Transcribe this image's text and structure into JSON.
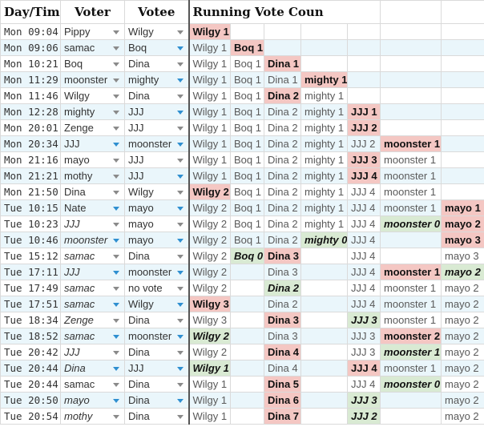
{
  "headers": {
    "day_time": "Day/Time",
    "voter": "Voter",
    "votee": "Votee",
    "running": "Running Vote Coun"
  },
  "colors": {
    "red_highlight": "#f4c7c3",
    "green_highlight": "#d9ead3",
    "alt_row": "#eaf6fb",
    "dropdown_blue": "#2f8fd0"
  },
  "rows": [
    {
      "time": "Mon 09:04",
      "voter": "Pippy",
      "votee": "Wilgy",
      "alt": false,
      "voter_arrow": "gray",
      "votee_arrow": "gray",
      "voter_italic": false,
      "counts": [
        {
          "t": "Wilgy 1",
          "s": "red"
        },
        {
          "t": "",
          "s": ""
        },
        {
          "t": "",
          "s": ""
        },
        {
          "t": "",
          "s": ""
        },
        {
          "t": "",
          "s": ""
        },
        {
          "t": "",
          "s": ""
        },
        {
          "t": "",
          "s": ""
        }
      ]
    },
    {
      "time": "Mon 09:06",
      "voter": "samac",
      "votee": "Boq",
      "alt": true,
      "voter_arrow": "gray",
      "votee_arrow": "blue",
      "voter_italic": false,
      "counts": [
        {
          "t": "Wilgy 1",
          "s": ""
        },
        {
          "t": "Boq 1",
          "s": "red"
        },
        {
          "t": "",
          "s": ""
        },
        {
          "t": "",
          "s": ""
        },
        {
          "t": "",
          "s": ""
        },
        {
          "t": "",
          "s": ""
        },
        {
          "t": "",
          "s": ""
        }
      ]
    },
    {
      "time": "Mon 10:21",
      "voter": "Boq",
      "votee": "Dina",
      "alt": false,
      "voter_arrow": "gray",
      "votee_arrow": "gray",
      "voter_italic": false,
      "counts": [
        {
          "t": "Wilgy 1",
          "s": ""
        },
        {
          "t": "Boq 1",
          "s": ""
        },
        {
          "t": "Dina 1",
          "s": "red"
        },
        {
          "t": "",
          "s": ""
        },
        {
          "t": "",
          "s": ""
        },
        {
          "t": "",
          "s": ""
        },
        {
          "t": "",
          "s": ""
        }
      ]
    },
    {
      "time": "Mon 11:29",
      "voter": "moonster",
      "votee": "mighty",
      "alt": true,
      "voter_arrow": "gray",
      "votee_arrow": "blue",
      "voter_italic": false,
      "counts": [
        {
          "t": "Wilgy 1",
          "s": ""
        },
        {
          "t": "Boq 1",
          "s": ""
        },
        {
          "t": "Dina 1",
          "s": ""
        },
        {
          "t": "mighty 1",
          "s": "red"
        },
        {
          "t": "",
          "s": ""
        },
        {
          "t": "",
          "s": ""
        },
        {
          "t": "",
          "s": ""
        }
      ]
    },
    {
      "time": "Mon 11:46",
      "voter": "Wilgy",
      "votee": "Dina",
      "alt": false,
      "voter_arrow": "gray",
      "votee_arrow": "gray",
      "voter_italic": false,
      "counts": [
        {
          "t": "Wilgy 1",
          "s": ""
        },
        {
          "t": "Boq 1",
          "s": ""
        },
        {
          "t": "Dina 2",
          "s": "red"
        },
        {
          "t": "mighty 1",
          "s": ""
        },
        {
          "t": "",
          "s": ""
        },
        {
          "t": "",
          "s": ""
        },
        {
          "t": "",
          "s": ""
        }
      ]
    },
    {
      "time": "Mon 12:28",
      "voter": "mighty",
      "votee": "JJJ",
      "alt": true,
      "voter_arrow": "gray",
      "votee_arrow": "blue",
      "voter_italic": false,
      "counts": [
        {
          "t": "Wilgy 1",
          "s": ""
        },
        {
          "t": "Boq 1",
          "s": ""
        },
        {
          "t": "Dina 2",
          "s": ""
        },
        {
          "t": "mighty 1",
          "s": ""
        },
        {
          "t": "JJJ 1",
          "s": "red"
        },
        {
          "t": "",
          "s": ""
        },
        {
          "t": "",
          "s": ""
        }
      ]
    },
    {
      "time": "Mon 20:01",
      "voter": "Zenge",
      "votee": "JJJ",
      "alt": false,
      "voter_arrow": "gray",
      "votee_arrow": "gray",
      "voter_italic": false,
      "counts": [
        {
          "t": "Wilgy 1",
          "s": ""
        },
        {
          "t": "Boq 1",
          "s": ""
        },
        {
          "t": "Dina 2",
          "s": ""
        },
        {
          "t": "mighty 1",
          "s": ""
        },
        {
          "t": "JJJ 2",
          "s": "red"
        },
        {
          "t": "",
          "s": ""
        },
        {
          "t": "",
          "s": ""
        }
      ]
    },
    {
      "time": "Mon 20:34",
      "voter": "JJJ",
      "votee": "moonster",
      "alt": true,
      "voter_arrow": "blue",
      "votee_arrow": "blue",
      "voter_italic": false,
      "counts": [
        {
          "t": "Wilgy 1",
          "s": ""
        },
        {
          "t": "Boq 1",
          "s": ""
        },
        {
          "t": "Dina 2",
          "s": ""
        },
        {
          "t": "mighty 1",
          "s": ""
        },
        {
          "t": "JJJ 2",
          "s": ""
        },
        {
          "t": "moonster 1",
          "s": "red"
        },
        {
          "t": "",
          "s": ""
        }
      ]
    },
    {
      "time": "Mon 21:16",
      "voter": "mayo",
      "votee": "JJJ",
      "alt": false,
      "voter_arrow": "gray",
      "votee_arrow": "gray",
      "voter_italic": false,
      "counts": [
        {
          "t": "Wilgy 1",
          "s": ""
        },
        {
          "t": "Boq 1",
          "s": ""
        },
        {
          "t": "Dina 2",
          "s": ""
        },
        {
          "t": "mighty 1",
          "s": ""
        },
        {
          "t": "JJJ 3",
          "s": "red"
        },
        {
          "t": "moonster 1",
          "s": ""
        },
        {
          "t": "",
          "s": ""
        }
      ]
    },
    {
      "time": "Mon 21:21",
      "voter": "mothy",
      "votee": "JJJ",
      "alt": true,
      "voter_arrow": "gray",
      "votee_arrow": "blue",
      "voter_italic": false,
      "counts": [
        {
          "t": "Wilgy 1",
          "s": ""
        },
        {
          "t": "Boq 1",
          "s": ""
        },
        {
          "t": "Dina 2",
          "s": ""
        },
        {
          "t": "mighty 1",
          "s": ""
        },
        {
          "t": "JJJ 4",
          "s": "red"
        },
        {
          "t": "moonster 1",
          "s": ""
        },
        {
          "t": "",
          "s": ""
        }
      ]
    },
    {
      "time": "Mon 21:50",
      "voter": "Dina",
      "votee": "Wilgy",
      "alt": false,
      "voter_arrow": "gray",
      "votee_arrow": "gray",
      "voter_italic": false,
      "counts": [
        {
          "t": "Wilgy 2",
          "s": "red"
        },
        {
          "t": "Boq 1",
          "s": ""
        },
        {
          "t": "Dina 2",
          "s": ""
        },
        {
          "t": "mighty 1",
          "s": ""
        },
        {
          "t": "JJJ 4",
          "s": ""
        },
        {
          "t": "moonster 1",
          "s": ""
        },
        {
          "t": "",
          "s": ""
        }
      ]
    },
    {
      "time": "Tue 10:15",
      "voter": "Nate",
      "votee": "mayo",
      "alt": true,
      "voter_arrow": "blue",
      "votee_arrow": "blue",
      "voter_italic": false,
      "counts": [
        {
          "t": "Wilgy 2",
          "s": ""
        },
        {
          "t": "Boq 1",
          "s": ""
        },
        {
          "t": "Dina 2",
          "s": ""
        },
        {
          "t": "mighty 1",
          "s": ""
        },
        {
          "t": "JJJ 4",
          "s": ""
        },
        {
          "t": "moonster 1",
          "s": ""
        },
        {
          "t": "mayo 1",
          "s": "red"
        }
      ]
    },
    {
      "time": "Tue 10:23",
      "voter": "JJJ",
      "votee": "mayo",
      "alt": false,
      "voter_arrow": "gray",
      "votee_arrow": "gray",
      "voter_italic": true,
      "counts": [
        {
          "t": "Wilgy 2",
          "s": ""
        },
        {
          "t": "Boq 1",
          "s": ""
        },
        {
          "t": "Dina 2",
          "s": ""
        },
        {
          "t": "mighty 1",
          "s": ""
        },
        {
          "t": "JJJ 4",
          "s": ""
        },
        {
          "t": "moonster 0",
          "s": "green"
        },
        {
          "t": "mayo 2",
          "s": "red"
        }
      ]
    },
    {
      "time": "Tue 10:46",
      "voter": "moonster",
      "votee": "mayo",
      "alt": true,
      "voter_arrow": "blue",
      "votee_arrow": "blue",
      "voter_italic": true,
      "counts": [
        {
          "t": "Wilgy 2",
          "s": ""
        },
        {
          "t": "Boq 1",
          "s": ""
        },
        {
          "t": "Dina 2",
          "s": ""
        },
        {
          "t": "mighty 0",
          "s": "green"
        },
        {
          "t": "JJJ 4",
          "s": ""
        },
        {
          "t": "",
          "s": ""
        },
        {
          "t": "mayo 3",
          "s": "red"
        }
      ]
    },
    {
      "time": "Tue 15:12",
      "voter": "samac",
      "votee": "Dina",
      "alt": false,
      "voter_arrow": "gray",
      "votee_arrow": "gray",
      "voter_italic": true,
      "counts": [
        {
          "t": "Wilgy 2",
          "s": ""
        },
        {
          "t": "Boq 0",
          "s": "green"
        },
        {
          "t": "Dina 3",
          "s": "red"
        },
        {
          "t": "",
          "s": ""
        },
        {
          "t": "JJJ 4",
          "s": ""
        },
        {
          "t": "",
          "s": ""
        },
        {
          "t": "mayo 3",
          "s": ""
        }
      ]
    },
    {
      "time": "Tue 17:11",
      "voter": "JJJ",
      "votee": "moonster",
      "alt": true,
      "voter_arrow": "blue",
      "votee_arrow": "blue",
      "voter_italic": true,
      "counts": [
        {
          "t": "Wilgy 2",
          "s": ""
        },
        {
          "t": "",
          "s": ""
        },
        {
          "t": "Dina 3",
          "s": ""
        },
        {
          "t": "",
          "s": ""
        },
        {
          "t": "JJJ 4",
          "s": ""
        },
        {
          "t": "moonster 1",
          "s": "red"
        },
        {
          "t": "mayo 2",
          "s": "green"
        }
      ]
    },
    {
      "time": "Tue 17:49",
      "voter": "samac",
      "votee": "no vote",
      "alt": false,
      "voter_arrow": "gray",
      "votee_arrow": "gray",
      "voter_italic": true,
      "counts": [
        {
          "t": "Wilgy 2",
          "s": ""
        },
        {
          "t": "",
          "s": ""
        },
        {
          "t": "Dina 2",
          "s": "green"
        },
        {
          "t": "",
          "s": ""
        },
        {
          "t": "JJJ 4",
          "s": ""
        },
        {
          "t": "moonster 1",
          "s": ""
        },
        {
          "t": "mayo 2",
          "s": ""
        }
      ]
    },
    {
      "time": "Tue 17:51",
      "voter": "samac",
      "votee": "Wilgy",
      "alt": true,
      "voter_arrow": "blue",
      "votee_arrow": "blue",
      "voter_italic": true,
      "counts": [
        {
          "t": "Wilgy 3",
          "s": "red"
        },
        {
          "t": "",
          "s": ""
        },
        {
          "t": "Dina 2",
          "s": ""
        },
        {
          "t": "",
          "s": ""
        },
        {
          "t": "JJJ 4",
          "s": ""
        },
        {
          "t": "moonster 1",
          "s": ""
        },
        {
          "t": "mayo 2",
          "s": ""
        }
      ]
    },
    {
      "time": "Tue 18:34",
      "voter": "Zenge",
      "votee": "Dina",
      "alt": false,
      "voter_arrow": "gray",
      "votee_arrow": "gray",
      "voter_italic": true,
      "counts": [
        {
          "t": "Wilgy 3",
          "s": ""
        },
        {
          "t": "",
          "s": ""
        },
        {
          "t": "Dina 3",
          "s": "red"
        },
        {
          "t": "",
          "s": ""
        },
        {
          "t": "JJJ 3",
          "s": "green"
        },
        {
          "t": "moonster 1",
          "s": ""
        },
        {
          "t": "mayo 2",
          "s": ""
        }
      ]
    },
    {
      "time": "Tue 18:52",
      "voter": "samac",
      "votee": "moonster",
      "alt": true,
      "voter_arrow": "blue",
      "votee_arrow": "blue",
      "voter_italic": true,
      "counts": [
        {
          "t": "Wilgy 2",
          "s": "green"
        },
        {
          "t": "",
          "s": ""
        },
        {
          "t": "Dina 3",
          "s": ""
        },
        {
          "t": "",
          "s": ""
        },
        {
          "t": "JJJ 3",
          "s": ""
        },
        {
          "t": "moonster 2",
          "s": "red"
        },
        {
          "t": "mayo 2",
          "s": ""
        }
      ]
    },
    {
      "time": "Tue 20:42",
      "voter": "JJJ",
      "votee": "Dina",
      "alt": false,
      "voter_arrow": "gray",
      "votee_arrow": "gray",
      "voter_italic": true,
      "counts": [
        {
          "t": "Wilgy 2",
          "s": ""
        },
        {
          "t": "",
          "s": ""
        },
        {
          "t": "Dina 4",
          "s": "red"
        },
        {
          "t": "",
          "s": ""
        },
        {
          "t": "JJJ 3",
          "s": ""
        },
        {
          "t": "moonster 1",
          "s": "green"
        },
        {
          "t": "mayo 2",
          "s": ""
        }
      ]
    },
    {
      "time": "Tue 20:44",
      "voter": "Dina",
      "votee": "JJJ",
      "alt": true,
      "voter_arrow": "blue",
      "votee_arrow": "blue",
      "voter_italic": true,
      "counts": [
        {
          "t": "Wilgy 1",
          "s": "green"
        },
        {
          "t": "",
          "s": ""
        },
        {
          "t": "Dina 4",
          "s": ""
        },
        {
          "t": "",
          "s": ""
        },
        {
          "t": "JJJ 4",
          "s": "red"
        },
        {
          "t": "moonster 1",
          "s": ""
        },
        {
          "t": "mayo 2",
          "s": ""
        }
      ]
    },
    {
      "time": "Tue 20:44",
      "voter": "samac",
      "votee": "Dina",
      "alt": false,
      "voter_arrow": "gray",
      "votee_arrow": "gray",
      "voter_italic": false,
      "counts": [
        {
          "t": "Wilgy 1",
          "s": ""
        },
        {
          "t": "",
          "s": ""
        },
        {
          "t": "Dina 5",
          "s": "red"
        },
        {
          "t": "",
          "s": ""
        },
        {
          "t": "JJJ 4",
          "s": ""
        },
        {
          "t": "moonster 0",
          "s": "green"
        },
        {
          "t": "mayo 2",
          "s": ""
        }
      ]
    },
    {
      "time": "Tue 20:50",
      "voter": "mayo",
      "votee": "Dina",
      "alt": true,
      "voter_arrow": "blue",
      "votee_arrow": "blue",
      "voter_italic": true,
      "counts": [
        {
          "t": "Wilgy 1",
          "s": ""
        },
        {
          "t": "",
          "s": ""
        },
        {
          "t": "Dina 6",
          "s": "red"
        },
        {
          "t": "",
          "s": ""
        },
        {
          "t": "JJJ 3",
          "s": "green"
        },
        {
          "t": "",
          "s": ""
        },
        {
          "t": "mayo 2",
          "s": ""
        }
      ]
    },
    {
      "time": "Tue 20:54",
      "voter": "mothy",
      "votee": "Dina",
      "alt": false,
      "voter_arrow": "gray",
      "votee_arrow": "gray",
      "voter_italic": true,
      "counts": [
        {
          "t": "Wilgy 1",
          "s": ""
        },
        {
          "t": "",
          "s": ""
        },
        {
          "t": "Dina 7",
          "s": "red"
        },
        {
          "t": "",
          "s": ""
        },
        {
          "t": "JJJ 2",
          "s": "green"
        },
        {
          "t": "",
          "s": ""
        },
        {
          "t": "mayo 2",
          "s": ""
        }
      ]
    }
  ]
}
